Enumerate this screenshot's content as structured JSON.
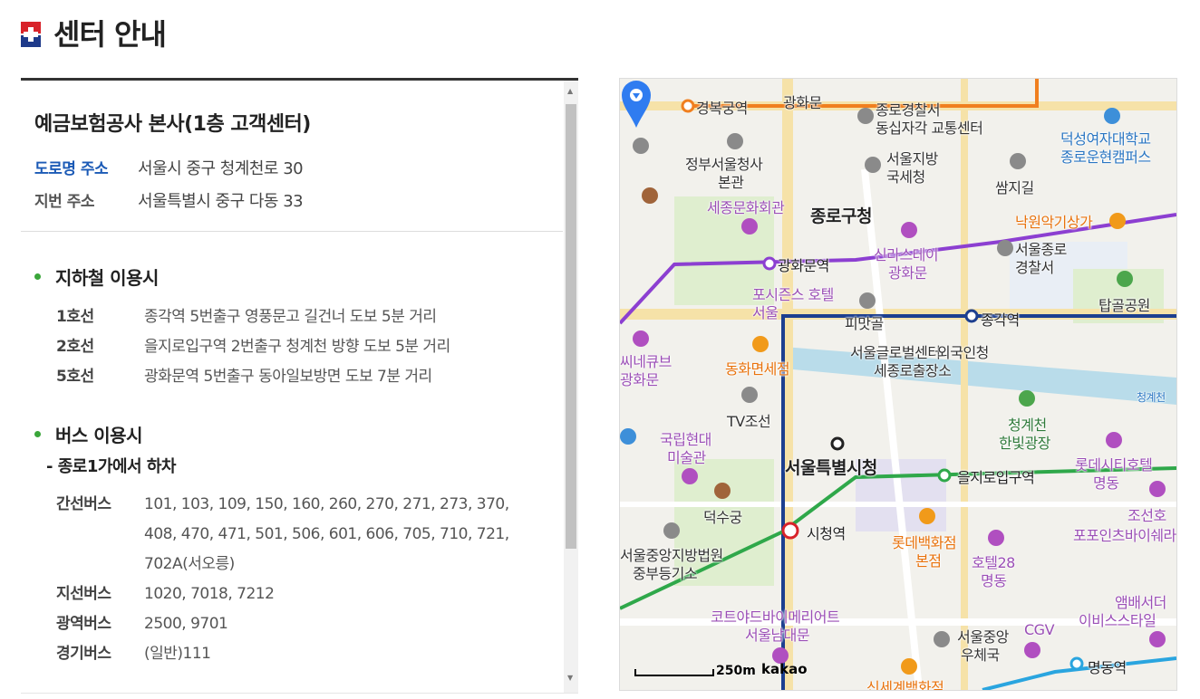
{
  "page": {
    "title": "센터 안내"
  },
  "center": {
    "name": "예금보험공사 본사(1층 고객센터)",
    "road_address_label": "도로명 주소",
    "road_address": "서울시 중구 청계천로 30",
    "lot_address_label": "지번 주소",
    "lot_address": "서울특별시 중구 다동 33"
  },
  "subway": {
    "title": "지하철 이용시",
    "lines": [
      {
        "line": "1호선",
        "desc": "종각역 5번출구 영풍문고 길건너 도보 5분 거리"
      },
      {
        "line": "2호선",
        "desc": "을지로입구역 2번출구 청계천 방향 도보 5분 거리"
      },
      {
        "line": "5호선",
        "desc": "광화문역 5번출구 동아일보방면 도보 7분 거리"
      }
    ]
  },
  "bus": {
    "title": "버스 이용시",
    "stop": "- 종로1가에서 하차",
    "types": [
      {
        "type": "간선버스",
        "routes": "101, 103, 109, 150, 160, 260, 270, 271, 273, 370, 408, 470, 471, 501, 506, 601, 606, 705, 710, 721, 702A(서오릉)"
      },
      {
        "type": "지선버스",
        "routes": "1020, 7018, 7212"
      },
      {
        "type": "광역버스",
        "routes": "2500, 9701"
      },
      {
        "type": "경기버스",
        "routes": "(일반)111"
      }
    ]
  },
  "map": {
    "scale": "250m",
    "provider": "kakao",
    "labels": [
      "경복궁역",
      "광화문",
      "종로경찰서",
      "동십자각 교통센터",
      "정부서울청사",
      "본관",
      "서울지방",
      "국세청",
      "쌈지길",
      "덕성여자대학교",
      "종로운현캠퍼스",
      "세종문화회관",
      "종로구청",
      "신라스테이",
      "광화문",
      "낙원악기상가",
      "서울종로",
      "경찰서",
      "광화문역",
      "포시즌스 호텔",
      "서울",
      "탑골공원",
      "피맛골",
      "종각역",
      "서울글로벌센터",
      "외국인청",
      "세종로출장소",
      "씨네큐브",
      "광화문",
      "동화면세점",
      "TV조선",
      "청계천",
      "한빛광장",
      "청계천",
      "국립현대",
      "미술관",
      "서울특별시청",
      "을지로입구역",
      "롯데시티호텔",
      "명동",
      "덕수궁",
      "시청역",
      "롯데백화점",
      "본점",
      "호텔28",
      "명동",
      "조선호",
      "포포인츠바이쉐라",
      "서울중앙지방법원",
      "중부등기소",
      "코트야드바이메리어트",
      "서울남대문",
      "서울중앙",
      "우체국",
      "CGV",
      "명동역",
      "앰배서더",
      "이비스스타일",
      "신세계백화점"
    ]
  },
  "colors": {
    "accent": "#1b5ab6",
    "bullet": "#3aa63a",
    "line1": "#1d3f8f",
    "line2": "#2fa84a",
    "line5": "#8c3fd1",
    "line3": "#f07f1f",
    "line4": "#2aa5df"
  }
}
